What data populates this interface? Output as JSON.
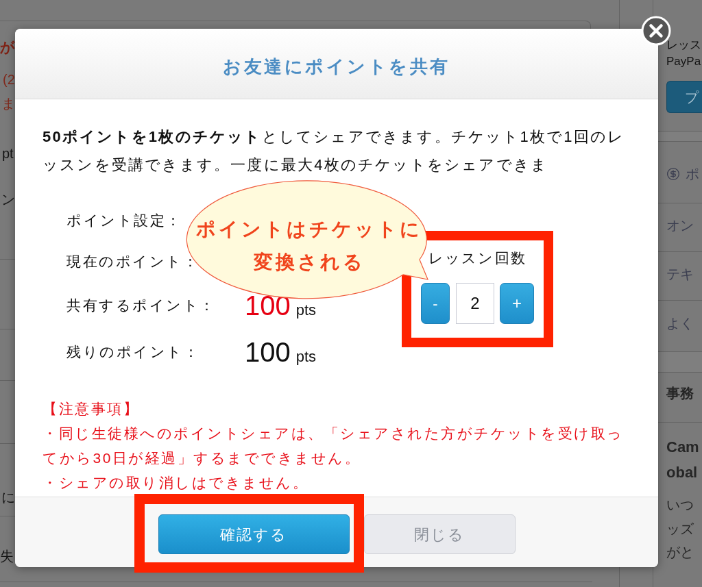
{
  "background": {
    "main": [
      {
        "text": "が",
        "kind": "alert"
      },
      {
        "text": "(2",
        "kind": "note"
      },
      {
        "text": "ま",
        "kind": "note"
      },
      {
        "text": "pt",
        "kind": "text"
      },
      {
        "text": "ン",
        "kind": "text"
      },
      {
        "text": "に",
        "kind": "text"
      },
      {
        "text": "失",
        "kind": "text"
      }
    ],
    "sidebar": {
      "lines": [
        "レッス",
        "PayPa"
      ],
      "button": "プ",
      "menu": [
        {
          "label": "ポ",
          "kind": "points"
        },
        {
          "label": "オン",
          "kind": "link"
        },
        {
          "label": "テキ",
          "kind": "link"
        },
        {
          "label": "よく",
          "kind": "link"
        }
      ],
      "heading": "事務",
      "title_lines": [
        "Cam",
        "obal"
      ],
      "body_lines": [
        "いつ",
        "ッズ",
        "がと"
      ]
    }
  },
  "dialog": {
    "title": "お友達にポイントを共有",
    "intro": "**50ポイントを1枚のチケット**としてシェアできます。チケット1枚で1回のレッスンを受講できます。一度に最大4枚のチケットをシェアできま",
    "rows": [
      {
        "label": "ポイント設定："
      },
      {
        "label": "現在のポイント："
      },
      {
        "label": "共有するポイント：",
        "value": "100",
        "unit": "pts",
        "emphasis": true
      },
      {
        "label": "残りのポイント：",
        "value": "100",
        "unit": "pts",
        "emphasis": false
      }
    ],
    "lesson_count": {
      "label": "レッスン回数",
      "decrement": "-",
      "value": "2",
      "increment": "+",
      "highlighted": true
    },
    "notes": {
      "heading": "【注意事項】",
      "items": [
        "・同じ生徒様へのポイントシェアは、「シェアされた方がチケットを受け取ってから30日が経過」するまでできません。",
        "・シェアの取り消しはできません。"
      ]
    },
    "buttons": [
      {
        "label": "確認する",
        "kind": "primary",
        "highlighted": true
      },
      {
        "label": "閉じる",
        "kind": "secondary",
        "highlighted": false
      }
    ]
  },
  "callout": {
    "text": "ポイントはチケットに変換される"
  }
}
